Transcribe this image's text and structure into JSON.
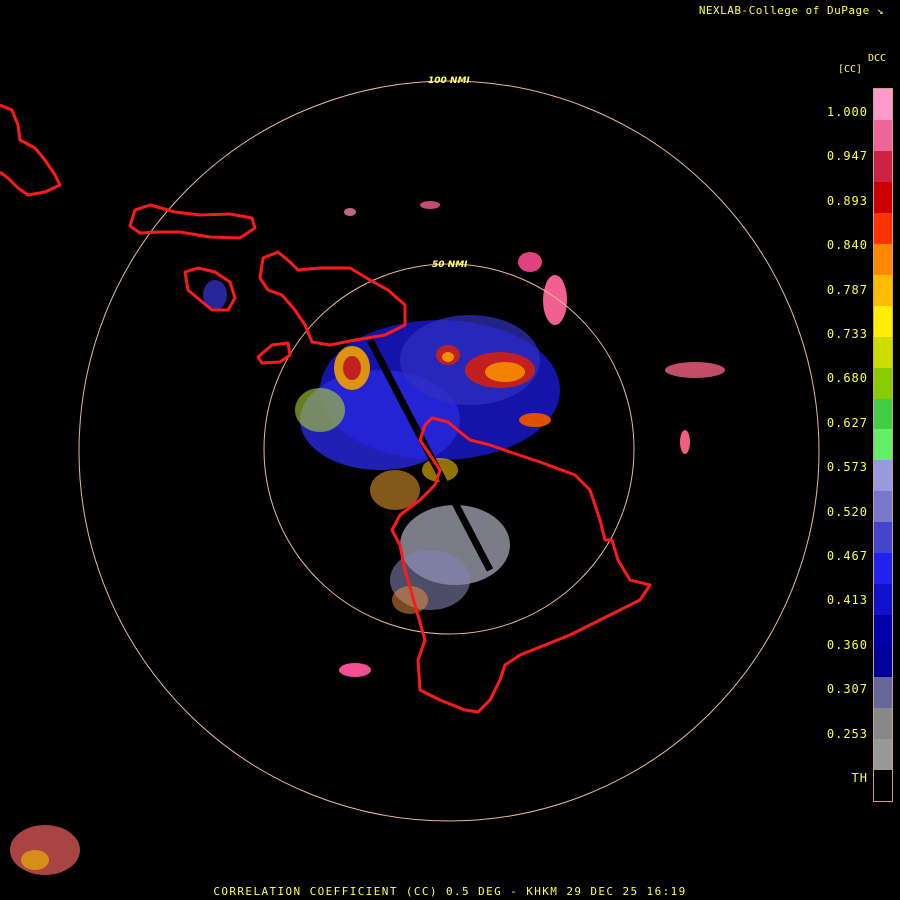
{
  "credit": "NEXLAB-College of DuPage ↘",
  "legend": {
    "product_code": "DCC",
    "unit": "[CC]",
    "ticks": [
      "1.000",
      "0.947",
      "0.893",
      "0.840",
      "0.787",
      "0.733",
      "0.680",
      "0.627",
      "0.573",
      "0.520",
      "0.467",
      "0.413",
      "0.360",
      "0.307",
      "0.253",
      "TH"
    ],
    "colors": [
      "#ff99cc",
      "#ee6699",
      "#cc2244",
      "#cc0000",
      "#ff3300",
      "#ff8800",
      "#ffbb00",
      "#ffee00",
      "#ccdd00",
      "#88cc00",
      "#44cc44",
      "#66ee66",
      "#9999dd",
      "#7777cc",
      "#4444cc",
      "#2222ee",
      "#1111cc",
      "#0000aa",
      "#000099",
      "#666699",
      "#888888",
      "#999999",
      "#000000"
    ]
  },
  "rings": {
    "outer_label": "100 NMI",
    "inner_label": "50 NMI"
  },
  "colors": {
    "coastline": "#ff1a1a",
    "ring": "#e8b89a",
    "text": "#ffff44"
  },
  "footer": "CORRELATION COEFFICIENT (CC) 0.5 DEG - KHKM 29 DEC 25 16:19"
}
